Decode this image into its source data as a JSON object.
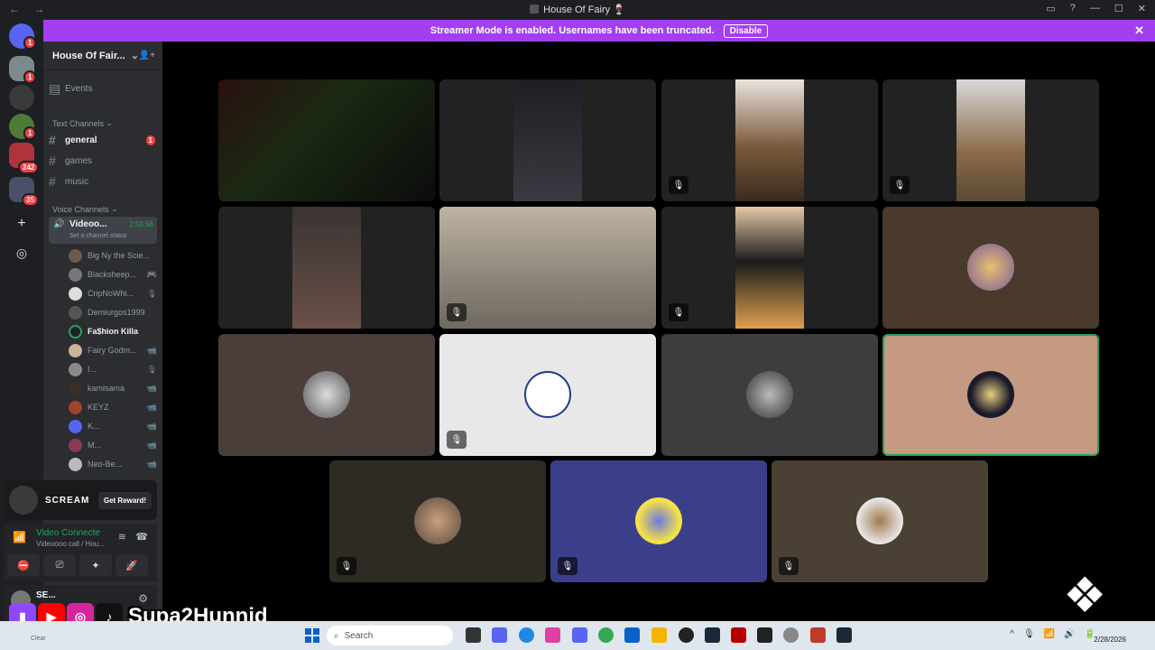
{
  "titlebar": {
    "title": "House Of Fairy 🍷",
    "back": "←",
    "forward": "→",
    "controls": [
      "▭",
      "?",
      "—",
      "☐",
      "✕"
    ]
  },
  "streamer": {
    "message": "Streamer Mode is enabled. Usernames have been truncated.",
    "disable": "Disable",
    "close": "✕"
  },
  "rail": {
    "badges": [
      "1",
      "1",
      "1",
      "242",
      "35"
    ],
    "add": "+",
    "discover": "◎"
  },
  "guild": {
    "name": "House Of Fair...",
    "chevron": "⌄",
    "invite": "👤+"
  },
  "sidebar": {
    "events": "Events",
    "text_header": "Text Channels",
    "text_channels": [
      {
        "name": "general",
        "badge": "1"
      },
      {
        "name": "games"
      },
      {
        "name": "music"
      }
    ],
    "voice_header": "Voice Channels",
    "voice_channel": {
      "name": "Videoo...",
      "timer": "2:50:56",
      "status": "Set a channel status"
    },
    "members": [
      {
        "name": "Big Ny the Scie...",
        "icon": ""
      },
      {
        "name": "Blacksheep...",
        "icon": "🎮"
      },
      {
        "name": "CripNoWhi...",
        "icon": "🎙"
      },
      {
        "name": "Demiurgos1999",
        "icon": ""
      },
      {
        "name": "Fa$hion Killa",
        "icon": ""
      },
      {
        "name": "Fairy Godm...",
        "icon": "📹"
      },
      {
        "name": "I...",
        "icon": "🎙"
      },
      {
        "name": "kamisama",
        "icon": "📹"
      },
      {
        "name": "KEYZ",
        "icon": "📹"
      },
      {
        "name": "K...",
        "icon": "📹"
      },
      {
        "name": "M...",
        "icon": "📹"
      },
      {
        "name": "Neo-Be...",
        "icon": "📹"
      }
    ]
  },
  "promo": {
    "brand": "SCREAM",
    "cta": "Get Reward!"
  },
  "voice_connection": {
    "status": "Video Connecte",
    "channel": "Videoooo call / Hou...",
    "buttons": [
      "⛔",
      "⎚",
      "✦",
      "🚀"
    ]
  },
  "user": {
    "name": "SE...",
    "settings": "⚙"
  },
  "overlay": {
    "handle": "Supa2Hunnid",
    "clear": "Clear"
  },
  "taskbar": {
    "search": "Search",
    "date": "2/28/2026",
    "tray": [
      "^",
      "🎙",
      "📶",
      "🔊",
      "🔋"
    ]
  },
  "tiles": [
    {
      "label": "tile-1"
    },
    {
      "label": "tile-2"
    },
    {
      "label": "tile-3",
      "muted": true
    },
    {
      "label": "tile-4",
      "muted": true
    },
    {
      "label": "tile-5"
    },
    {
      "label": "tile-6",
      "muted": true
    },
    {
      "label": "tile-7",
      "muted": true
    },
    {
      "label": "tile-8"
    },
    {
      "label": "tile-9"
    },
    {
      "label": "tile-10",
      "muted": true
    },
    {
      "label": "tile-11"
    },
    {
      "label": "tile-12",
      "speaking": true
    },
    {
      "label": "tile-13",
      "muted": true
    },
    {
      "label": "tile-14",
      "muted": true
    },
    {
      "label": "tile-15",
      "muted": true
    }
  ],
  "colors": {
    "accent": "#a33ff2",
    "speaking": "#23a55a",
    "badge": "#f23f43"
  }
}
